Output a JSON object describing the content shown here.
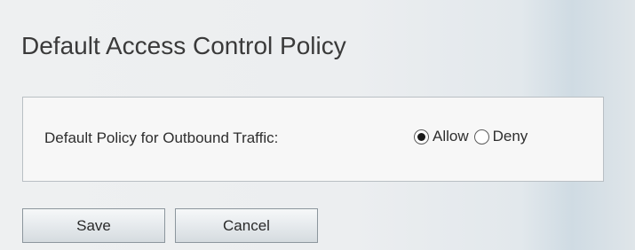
{
  "page": {
    "title": "Default Access Control Policy"
  },
  "policy": {
    "label": "Default Policy for Outbound Traffic:",
    "options": [
      {
        "label": "Allow",
        "checked": true
      },
      {
        "label": "Deny",
        "checked": false
      }
    ],
    "selected": "Allow"
  },
  "buttons": {
    "save_label": "Save",
    "cancel_label": "Cancel"
  },
  "colors": {
    "text": "#3a3a3a",
    "panel_border": "#b9bfc4",
    "panel_background": "#f7f7f7",
    "button_border": "#8c969d"
  }
}
